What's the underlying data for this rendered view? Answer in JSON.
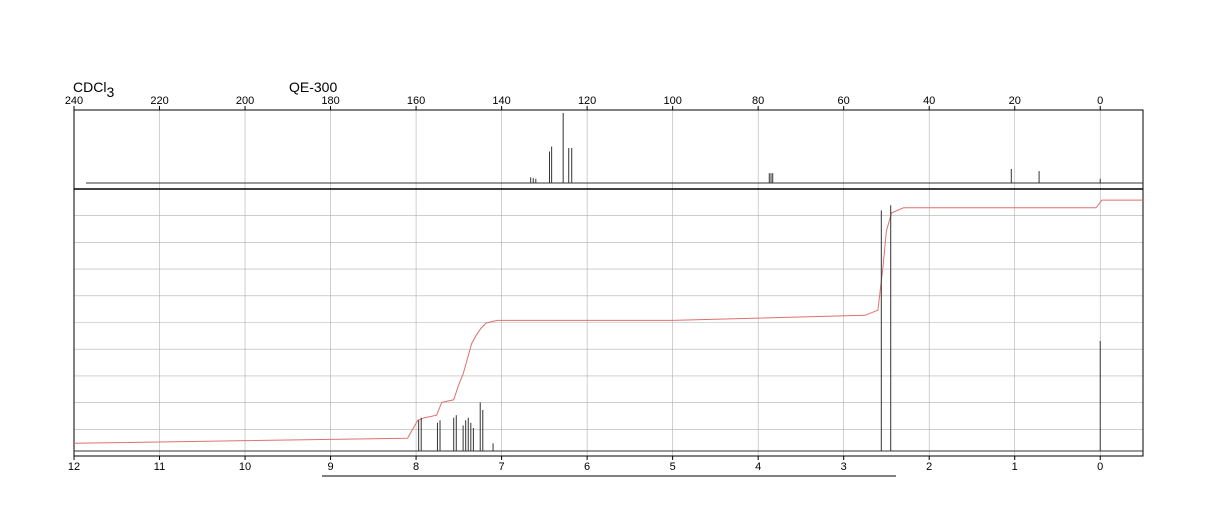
{
  "header": {
    "solvent_main": "CDCl",
    "solvent_sub": "3",
    "instrument": "QE-300"
  },
  "chart_data": [
    {
      "type": "line",
      "panel": "13C NMR",
      "x_ticks": [
        240,
        220,
        200,
        180,
        160,
        140,
        120,
        100,
        80,
        60,
        40,
        20,
        0
      ],
      "xlim": [
        240,
        -10
      ],
      "x_reversed": true,
      "grid": "vertical",
      "peaks": [
        {
          "x": 133.2,
          "y": 0.08
        },
        {
          "x": 132.6,
          "y": 0.07
        },
        {
          "x": 132.0,
          "y": 0.06
        },
        {
          "x": 128.8,
          "y": 0.45
        },
        {
          "x": 128.3,
          "y": 0.52
        },
        {
          "x": 125.6,
          "y": 1.0
        },
        {
          "x": 124.3,
          "y": 0.5
        },
        {
          "x": 123.6,
          "y": 0.5
        },
        {
          "x": 77.4,
          "y": 0.14
        },
        {
          "x": 77.0,
          "y": 0.14
        },
        {
          "x": 76.6,
          "y": 0.14
        },
        {
          "x": 20.8,
          "y": 0.2
        },
        {
          "x": 14.3,
          "y": 0.17
        },
        {
          "x": 0.0,
          "y": 0.06
        }
      ]
    },
    {
      "type": "line",
      "panel": "1H NMR",
      "x_ticks": [
        12,
        11,
        10,
        9,
        8,
        7,
        6,
        5,
        4,
        3,
        2,
        1,
        0
      ],
      "xlim": [
        12,
        -0.5
      ],
      "x_reversed": true,
      "grid": "both",
      "peaks": [
        {
          "x": 7.97,
          "y": 0.12
        },
        {
          "x": 7.94,
          "y": 0.13
        },
        {
          "x": 7.75,
          "y": 0.11
        },
        {
          "x": 7.72,
          "y": 0.12
        },
        {
          "x": 7.56,
          "y": 0.13
        },
        {
          "x": 7.53,
          "y": 0.14
        },
        {
          "x": 7.45,
          "y": 0.1
        },
        {
          "x": 7.42,
          "y": 0.12
        },
        {
          "x": 7.39,
          "y": 0.13
        },
        {
          "x": 7.36,
          "y": 0.11
        },
        {
          "x": 7.33,
          "y": 0.09
        },
        {
          "x": 7.25,
          "y": 0.19
        },
        {
          "x": 7.22,
          "y": 0.16
        },
        {
          "x": 7.1,
          "y": 0.03
        },
        {
          "x": 2.56,
          "y": 0.94
        },
        {
          "x": 2.45,
          "y": 0.96
        },
        {
          "x": 0.0,
          "y": 0.43
        }
      ],
      "integral": [
        {
          "x": 12.0,
          "y": 0.03
        },
        {
          "x": 8.1,
          "y": 0.05
        },
        {
          "x": 7.98,
          "y": 0.12
        },
        {
          "x": 7.9,
          "y": 0.13
        },
        {
          "x": 7.76,
          "y": 0.14
        },
        {
          "x": 7.7,
          "y": 0.19
        },
        {
          "x": 7.56,
          "y": 0.2
        },
        {
          "x": 7.5,
          "y": 0.26
        },
        {
          "x": 7.45,
          "y": 0.3
        },
        {
          "x": 7.4,
          "y": 0.36
        },
        {
          "x": 7.35,
          "y": 0.42
        },
        {
          "x": 7.3,
          "y": 0.45
        },
        {
          "x": 7.24,
          "y": 0.48
        },
        {
          "x": 7.18,
          "y": 0.5
        },
        {
          "x": 7.05,
          "y": 0.51
        },
        {
          "x": 5.0,
          "y": 0.51
        },
        {
          "x": 2.75,
          "y": 0.53
        },
        {
          "x": 2.6,
          "y": 0.55
        },
        {
          "x": 2.54,
          "y": 0.72
        },
        {
          "x": 2.5,
          "y": 0.86
        },
        {
          "x": 2.44,
          "y": 0.93
        },
        {
          "x": 2.3,
          "y": 0.95
        },
        {
          "x": 0.05,
          "y": 0.95
        },
        {
          "x": -0.02,
          "y": 0.98
        },
        {
          "x": -0.5,
          "y": 0.98
        }
      ]
    }
  ],
  "colors": {
    "axis": "#000000",
    "grid": "#b0b0b0",
    "spectrum": "#333333",
    "integral": "#e0706e"
  }
}
